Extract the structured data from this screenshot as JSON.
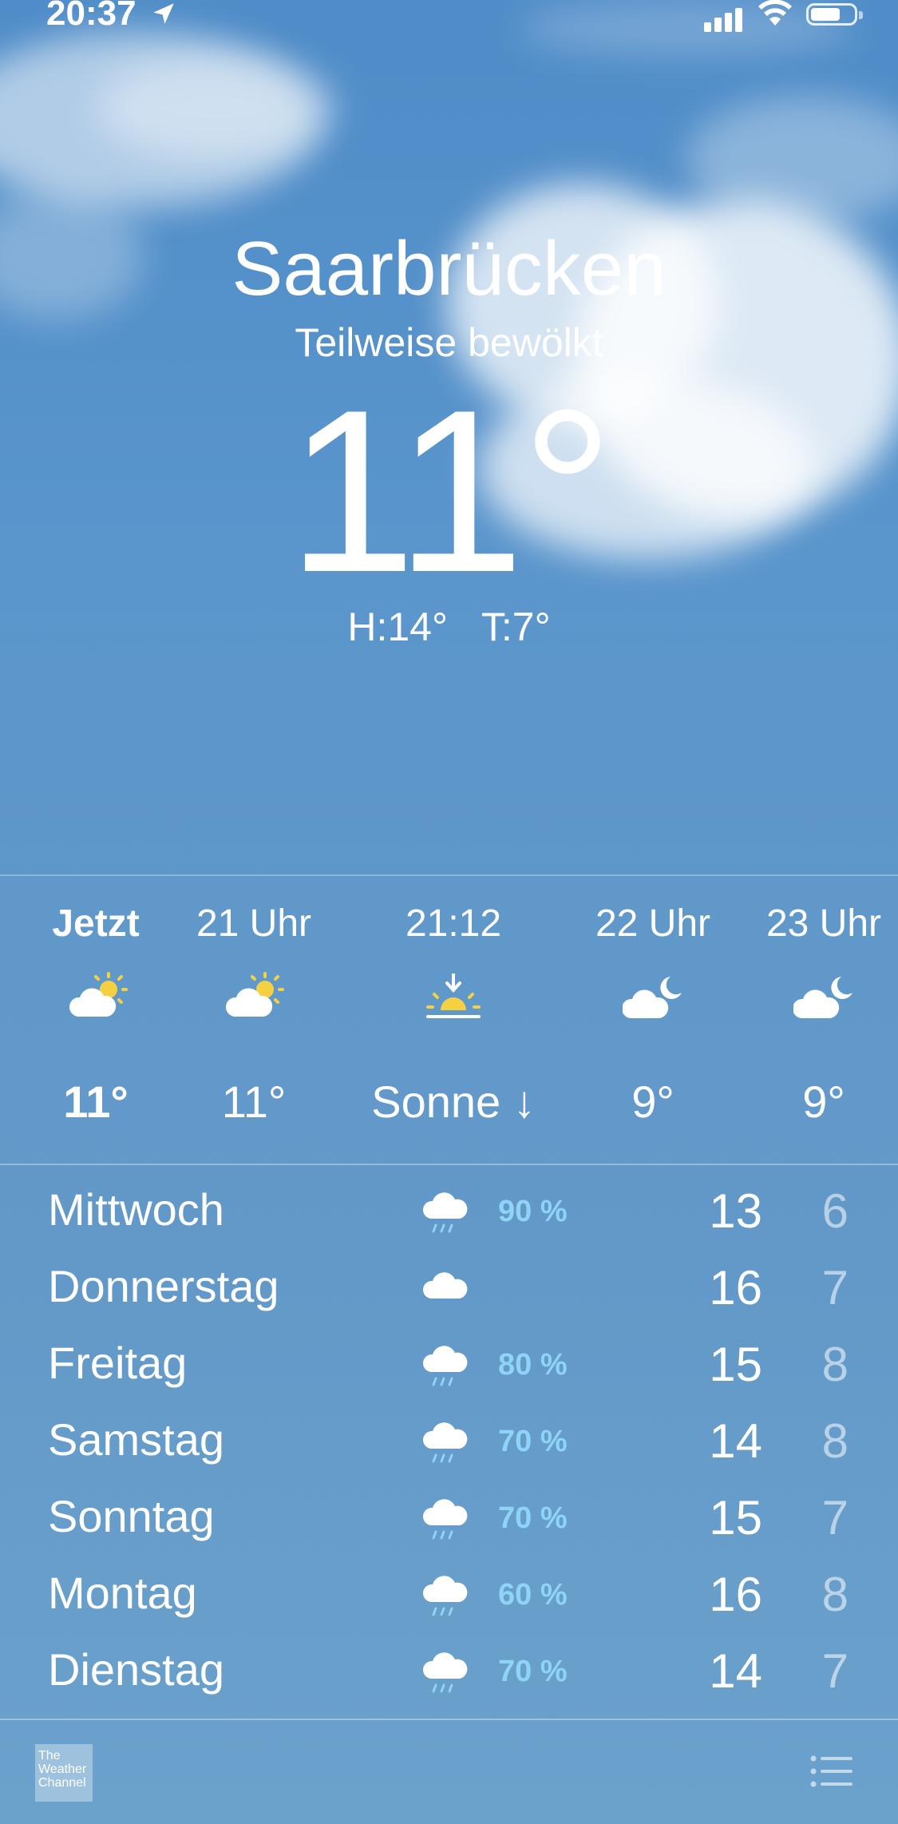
{
  "status_bar": {
    "time": "20:37",
    "location_icon": "location-arrow-icon",
    "signal": "cellular-signal-icon",
    "wifi": "wifi-icon",
    "battery": "battery-icon"
  },
  "current": {
    "city": "Saarbrücken",
    "condition": "Teilweise bewölkt",
    "temperature": "11°",
    "high": "H:14°",
    "low": "T:7°"
  },
  "hourly": [
    {
      "label": "Jetzt",
      "icon": "partly-cloudy-sun-icon",
      "temp": "11°",
      "bold": true
    },
    {
      "label": "21 Uhr",
      "icon": "partly-cloudy-sun-icon",
      "temp": "11°",
      "bold": false
    },
    {
      "label": "21:12",
      "icon": "sunset-icon",
      "temp": "Sonne ↓",
      "bold": false
    },
    {
      "label": "22 Uhr",
      "icon": "partly-cloudy-moon-icon",
      "temp": "9°",
      "bold": false
    },
    {
      "label": "23 Uhr",
      "icon": "partly-cloudy-moon-icon",
      "temp": "9°",
      "bold": false
    }
  ],
  "daily": [
    {
      "day": "Mittwoch",
      "icon": "rain-cloud-icon",
      "precip": "90 %",
      "high": "13",
      "low": "6"
    },
    {
      "day": "Donnerstag",
      "icon": "cloud-icon",
      "precip": "",
      "high": "16",
      "low": "7"
    },
    {
      "day": "Freitag",
      "icon": "rain-cloud-icon",
      "precip": "80 %",
      "high": "15",
      "low": "8"
    },
    {
      "day": "Samstag",
      "icon": "rain-cloud-icon",
      "precip": "70 %",
      "high": "14",
      "low": "8"
    },
    {
      "day": "Sonntag",
      "icon": "rain-cloud-icon",
      "precip": "70 %",
      "high": "15",
      "low": "7"
    },
    {
      "day": "Montag",
      "icon": "rain-cloud-icon",
      "precip": "60 %",
      "high": "16",
      "low": "8"
    },
    {
      "day": "Dienstag",
      "icon": "rain-cloud-icon",
      "precip": "70 %",
      "high": "14",
      "low": "7"
    }
  ],
  "footer": {
    "logo_text": "The Weather Channel",
    "list_icon": "list-icon"
  },
  "colors": {
    "precip": "#8fd3f6",
    "sun": "#f5d142"
  }
}
